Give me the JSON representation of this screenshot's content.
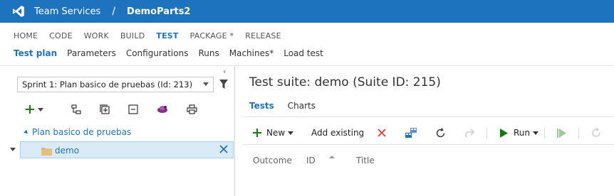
{
  "topbar": {
    "product": "Team Services",
    "separator": "/",
    "project": "DemoParts2",
    "icons": [
      "visual-studio-logo"
    ]
  },
  "hub_nav": [
    "HOME",
    "CODE",
    "WORK",
    "BUILD",
    "TEST",
    "PACKAGE *",
    "RELEASE"
  ],
  "hub_nav_active": "TEST",
  "sub_nav": [
    "Test plan",
    "Parameters",
    "Configurations",
    "Runs",
    "Machines*",
    "Load test"
  ],
  "sub_nav_active": "Test plan",
  "left_pane": {
    "plan_select_value": "Sprint 1: Plan basico de pruebas (Id: 213)",
    "tree_toolbar_icons": [
      "add-icon",
      "dropdown-icon",
      "hierarchy-icon",
      "expand-icon",
      "collapse-icon",
      "team-icon",
      "print-icon"
    ],
    "tree": {
      "root_label": "Plan basico de pruebas",
      "selected_label": "demo"
    }
  },
  "right_pane": {
    "title": "Test suite: demo (Suite ID: 215)",
    "tabs": [
      "Tests",
      "Charts"
    ],
    "active_tab": "Tests",
    "toolbar": {
      "new_label": "New",
      "add_existing_label": "Add existing",
      "run_label": "Run"
    },
    "grid_columns": [
      "Outcome",
      "ID",
      "Title"
    ]
  },
  "colors": {
    "brand": "#1e73be",
    "selected_row": "#daeaf7",
    "delete_red": "#e23a3a",
    "run_green": "#107c10"
  }
}
